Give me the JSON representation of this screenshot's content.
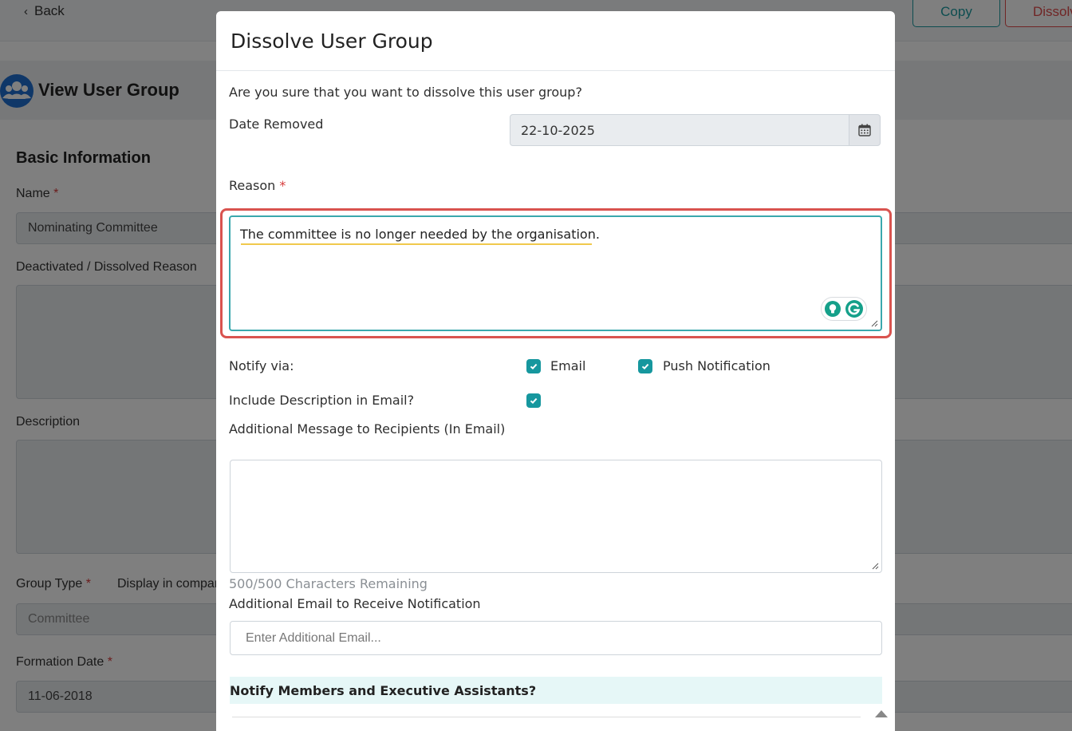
{
  "topbar": {
    "back_label": "Back",
    "copy_label": "Copy",
    "dissolve_label": "Dissolve"
  },
  "page": {
    "title": "View User Group",
    "section_title": "Basic Information",
    "name_label": "Name",
    "name_value": "Nominating Committee",
    "deactivated_label": "Deactivated / Dissolved Reason",
    "description_label": "Description",
    "group_type_label": "Group Type",
    "display_label": "Display in company",
    "group_type_value": "Committee",
    "formation_label": "Formation Date",
    "formation_value": "11-06-2018",
    "required_mark": "*"
  },
  "modal": {
    "title": "Dissolve User Group",
    "confirm_text": "Are you sure that you want to dissolve this user group?",
    "date_removed_label": "Date Removed",
    "date_removed_value": "22-10-2025",
    "reason_label": "Reason",
    "required_mark": "*",
    "reason_value": "The committee is no longer needed by the organisation.",
    "notify_via_label": "Notify via:",
    "email_option": "Email",
    "push_option": "Push Notification",
    "include_desc_label": "Include Description in Email?",
    "additional_msg_label": "Additional Message to Recipients (In Email)",
    "chars_remaining": "500/500 Characters Remaining",
    "additional_email_label": "Additional Email to Receive Notification",
    "additional_email_placeholder": "Enter Additional Email...",
    "notify_members_label": "Notify Members and Executive Assistants?"
  },
  "checkboxes": {
    "email_checked": true,
    "push_checked": true,
    "include_desc_checked": true
  },
  "colors": {
    "accent_teal": "#16979e",
    "highlight_red": "#d9534f",
    "brand_blue": "#1f6fd1"
  },
  "icons": [
    "chevron-left-icon",
    "users-icon",
    "calendar-icon",
    "lightbulb-icon",
    "grammarly-icon",
    "check-icon",
    "resize-grip-icon",
    "scroll-up-icon"
  ]
}
